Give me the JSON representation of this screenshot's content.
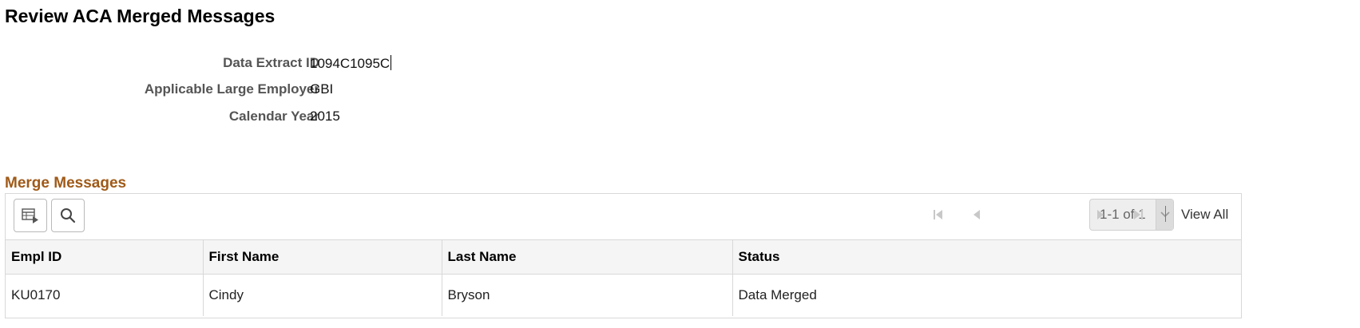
{
  "page": {
    "title": "Review ACA Merged Messages"
  },
  "fields": [
    {
      "label": "Data Extract ID",
      "value": "1094C1095C"
    },
    {
      "label": "Applicable Large Employer",
      "value": "GBI"
    },
    {
      "label": "Calendar Year",
      "value": "2015"
    }
  ],
  "merge_messages": {
    "title": "Merge Messages",
    "pagination": {
      "page_text": "1-1 of 1",
      "view_all": "View All"
    },
    "columns": [
      "Empl ID",
      "First Name",
      "Last Name",
      "Status"
    ],
    "rows": [
      [
        "KU0170",
        "Cindy",
        "Bryson",
        "Data Merged"
      ]
    ]
  },
  "icons": {
    "personalize": "grid-personalize-icon",
    "search": "search-icon",
    "first": "first-page-icon",
    "prev": "previous-page-icon",
    "next": "next-page-icon",
    "last": "last-page-icon",
    "dropdown": "chevron-down-icon"
  },
  "colors": {
    "section_title": "#a05a18",
    "header_bg": "#f5f5f5"
  }
}
